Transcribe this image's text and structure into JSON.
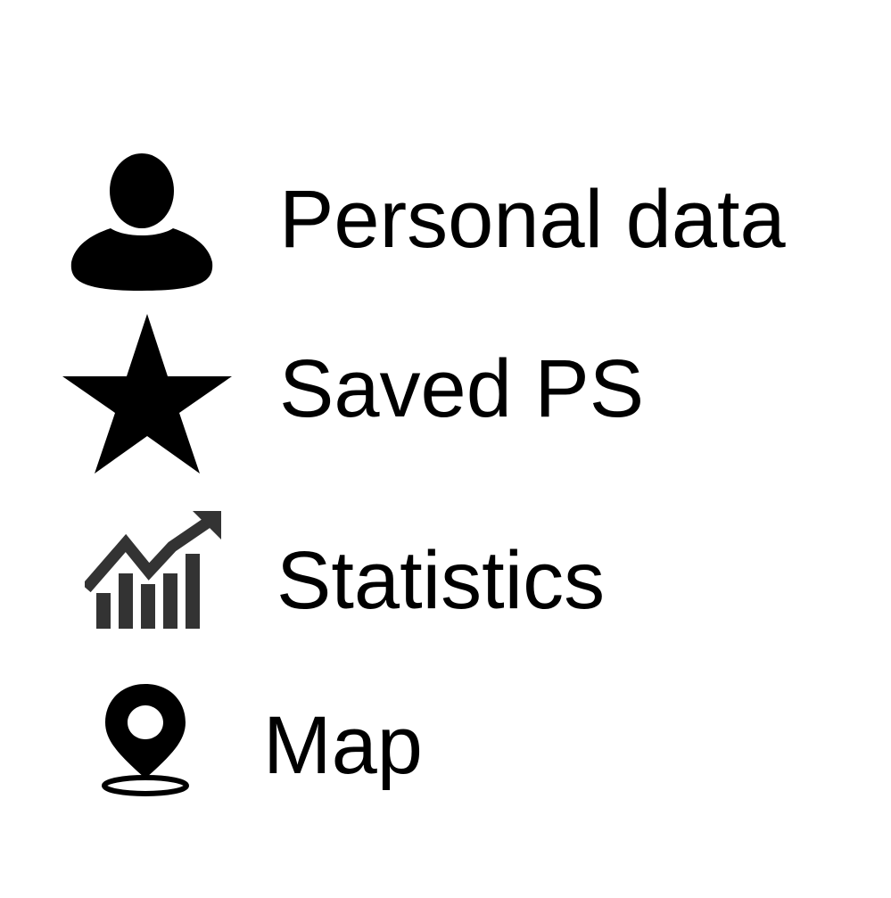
{
  "menu": {
    "items": [
      {
        "label": "Personal data",
        "icon": "user-icon",
        "icon_color": "#000000"
      },
      {
        "label": "Saved PS",
        "icon": "star-icon",
        "icon_color": "#000000"
      },
      {
        "label": "Statistics",
        "icon": "chart-trend-icon",
        "icon_color": "#333333"
      },
      {
        "label": "Map",
        "icon": "map-pin-icon",
        "icon_color": "#000000"
      }
    ]
  }
}
